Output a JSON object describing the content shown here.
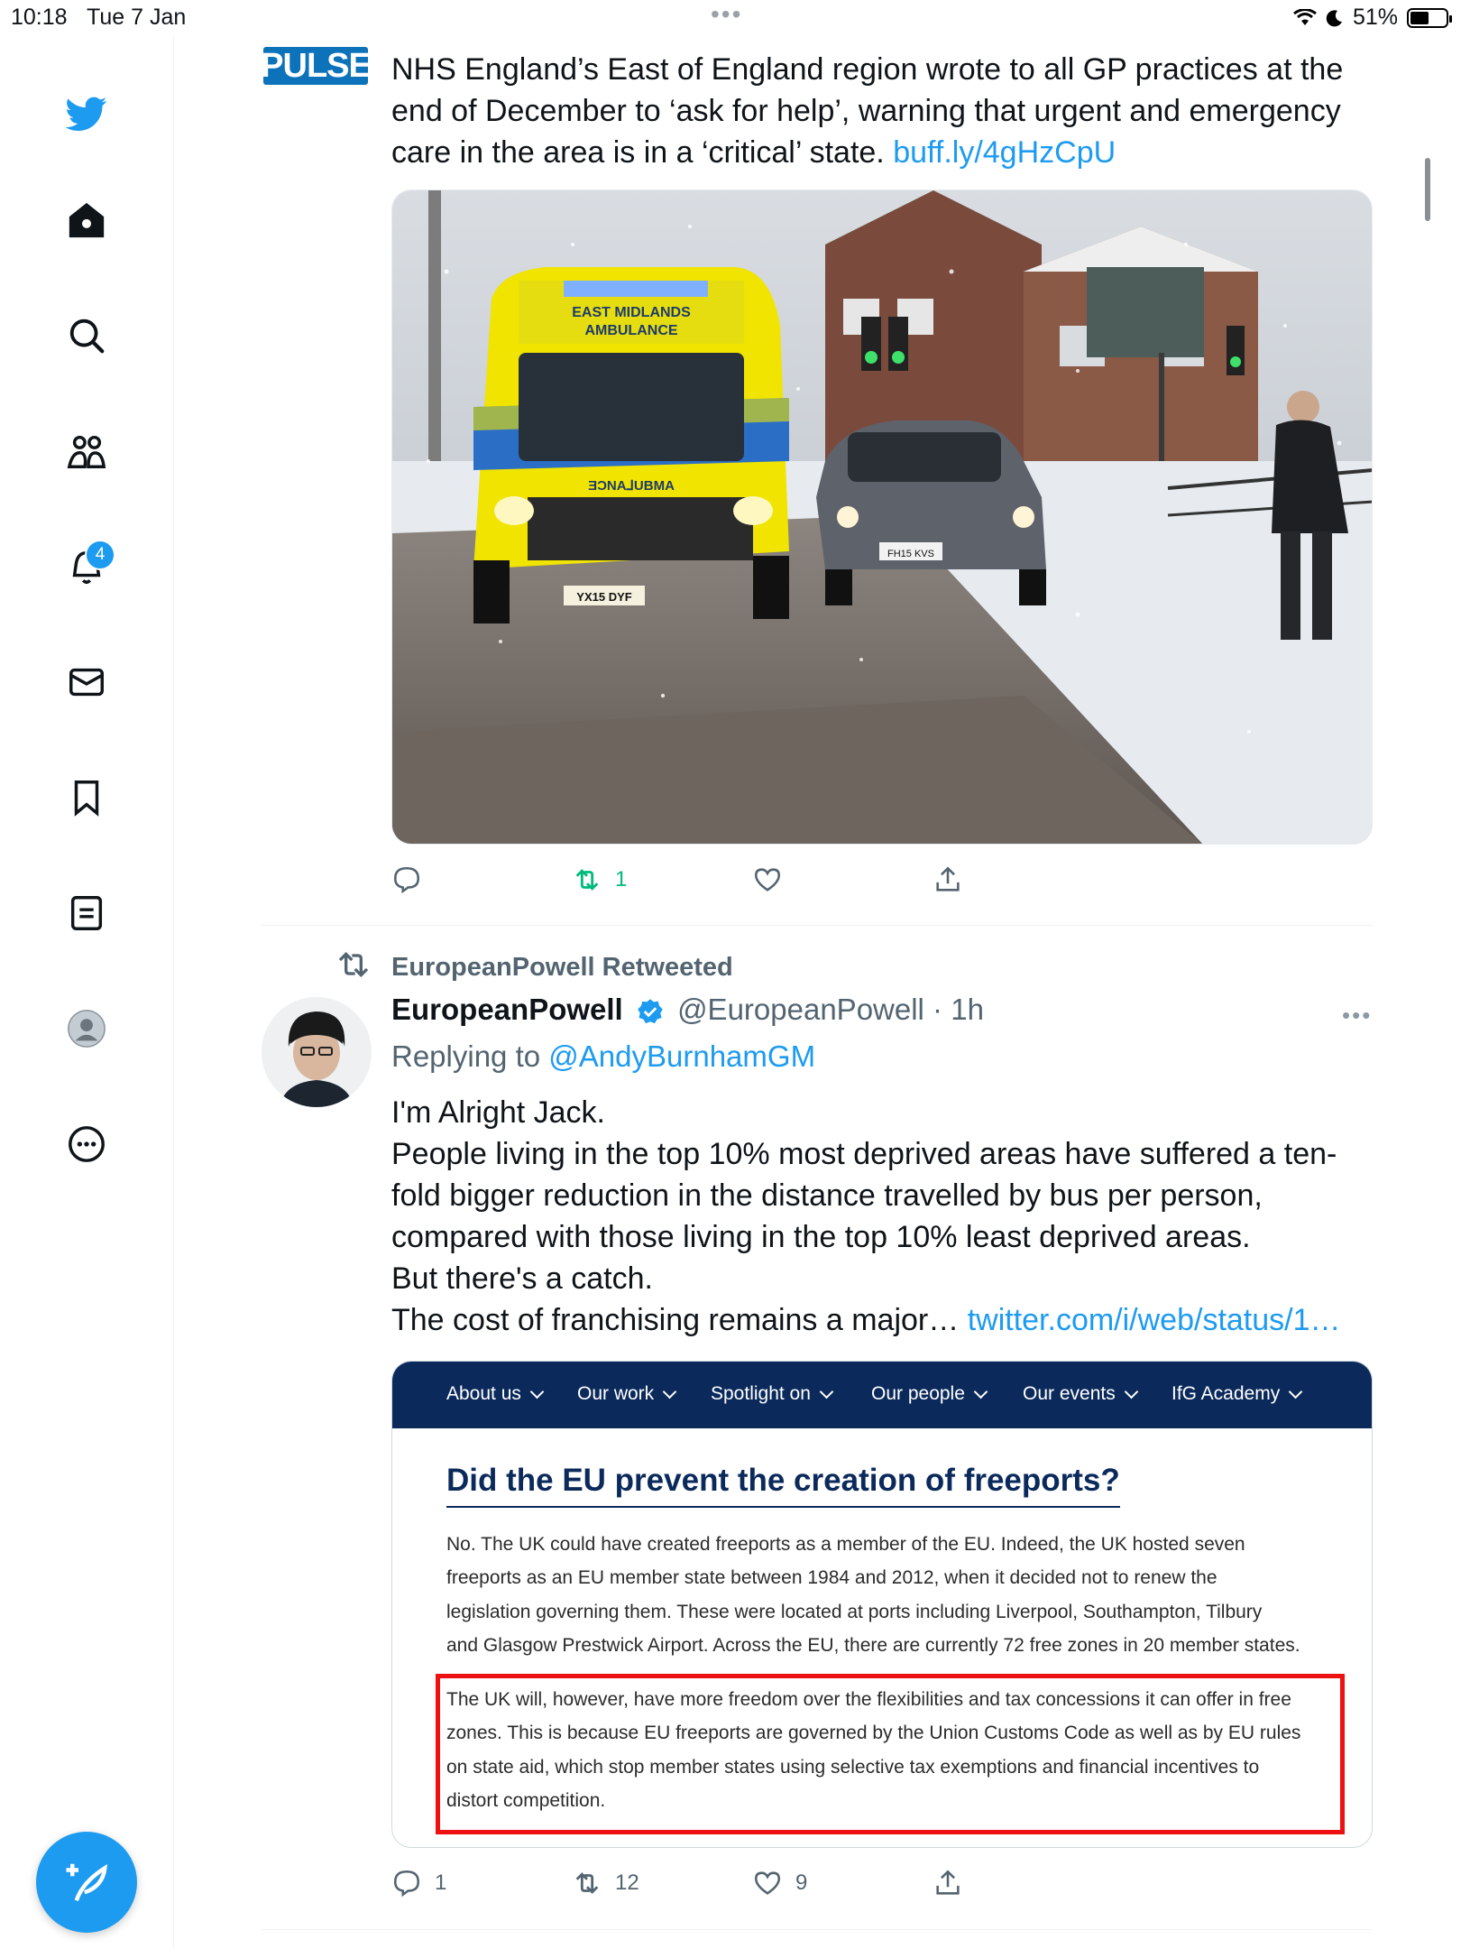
{
  "status_bar": {
    "time": "10:18",
    "date": "Tue 7 Jan",
    "battery": "51%",
    "dots": "•••"
  },
  "sidebar": {
    "items": [
      {
        "name": "twitter-logo-icon"
      },
      {
        "name": "home-icon"
      },
      {
        "name": "search-icon"
      },
      {
        "name": "communities-icon"
      },
      {
        "name": "notifications-icon",
        "badge": "4"
      },
      {
        "name": "messages-icon"
      },
      {
        "name": "bookmarks-icon"
      },
      {
        "name": "lists-icon"
      },
      {
        "name": "profile-icon"
      },
      {
        "name": "more-icon"
      }
    ],
    "notification_badge": "4"
  },
  "tweet1": {
    "logo_text": "PULSE",
    "text_line1": "NHS England’s East of England region wrote to all GP practices at the",
    "text_line2": "end of December to ‘ask for help’, warning that urgent and emergency",
    "text_line3": "care in the area is in a ‘critical’ state.",
    "link": "buff.ly/4gHzCpU",
    "media": {
      "ambulance_text_top": "EAST MIDLANDS",
      "ambulance_text_bottom": "AMBULANCE",
      "ambulance_mirror": "ƎƆNA⅃UBMA",
      "plate": "YX15 DYF",
      "car_plate": "FH15 KVS"
    },
    "retweet_count": "1"
  },
  "tweet2": {
    "retweeted_by": "EuropeanPowell Retweeted",
    "author_name": "EuropeanPowell",
    "author_handle": "@EuropeanPowell · 1h",
    "replying_label": "Replying to",
    "replying_to": "@AndyBurnhamGM",
    "more": "•••",
    "lines": [
      "I'm Alright Jack.",
      "People living in the top 10% most deprived areas have suffered a ten-",
      "fold bigger reduction in the distance travelled by bus per person,",
      "compared with those living in the top 10% least deprived areas.",
      "But there's a catch."
    ],
    "last_line": "The cost of franchising remains a major…",
    "link": "twitter.com/i/web/status/1…",
    "card": {
      "nav": [
        "About us",
        "Our work",
        "Spotlight on",
        "Our people",
        "Our events",
        "IfG Academy"
      ],
      "title": "Did the EU prevent the creation of freeports?",
      "para1": [
        "No. The UK could have created freeports as a member of the EU. Indeed, the UK hosted seven",
        "freeports as an EU member state between 1984 and 2012, when it decided not to renew the",
        "legislation governing them. These were located at ports including Liverpool, Southampton, Tilbury",
        "and Glasgow Prestwick Airport. Across the EU, there are currently 72 free zones in 20 member states."
      ],
      "para2": [
        "The UK will, however, have more freedom over the flexibilities and tax concessions it can offer in free",
        "zones. This is because EU freeports are governed by the Union Customs Code as well as by EU rules",
        "on state aid, which stop member states using selective tax exemptions and financial incentives to",
        "distort competition."
      ],
      "highlight_color": "#ee1111"
    },
    "reply_count": "1",
    "retweet_count": "12",
    "like_count": "9"
  },
  "colors": {
    "accent": "#1d9bf0",
    "retweet_green": "#00ba7c",
    "card_nav": "#0b2a5b"
  }
}
